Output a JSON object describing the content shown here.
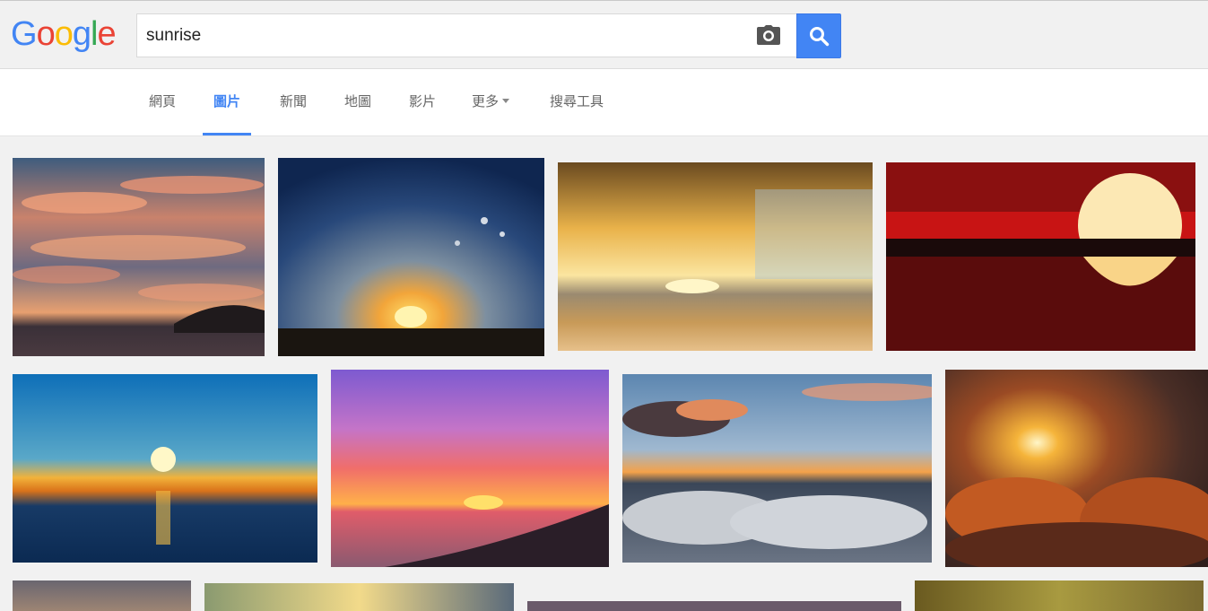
{
  "logo": {
    "letters": [
      "G",
      "o",
      "o",
      "g",
      "l",
      "e"
    ],
    "colors": [
      "#4285f4",
      "#ea4335",
      "#fbbc05",
      "#4285f4",
      "#34a853",
      "#ea4335"
    ]
  },
  "search": {
    "query": "sunrise",
    "camera_icon": "camera-icon",
    "search_icon": "search-icon",
    "accent": "#4285f4"
  },
  "tabs": [
    {
      "label": "網頁"
    },
    {
      "label": "圖片",
      "active": true
    },
    {
      "label": "新聞"
    },
    {
      "label": "地圖"
    },
    {
      "label": "影片"
    },
    {
      "label": "更多",
      "dropdown": true
    },
    {
      "label": "搜尋工具"
    }
  ],
  "results": {
    "thumbnails": [
      {
        "subject": "sunset-clouds-pink"
      },
      {
        "subject": "sun-rays-blue-sky"
      },
      {
        "subject": "golden-beach"
      },
      {
        "subject": "red-sun-reflection"
      },
      {
        "subject": "blue-sea-sunrise"
      },
      {
        "subject": "purple-pink-sky"
      },
      {
        "subject": "sea-of-clouds"
      },
      {
        "subject": "sunburst-clouds"
      },
      {
        "subject": "partial-1"
      },
      {
        "subject": "partial-2"
      },
      {
        "subject": "partial-3"
      },
      {
        "subject": "partial-4"
      }
    ]
  }
}
